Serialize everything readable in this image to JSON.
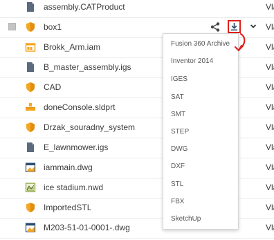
{
  "files": [
    {
      "name": "assembly.CATProduct",
      "icon": "document-icon",
      "owner": "Vla",
      "selected": false
    },
    {
      "name": "box1",
      "icon": "shield-part-icon",
      "owner": "Vla",
      "selected": true
    },
    {
      "name": "Brokk_Arm.iam",
      "icon": "assembly-icon",
      "owner": "Vla",
      "selected": false
    },
    {
      "name": "B_master_assembly.igs",
      "icon": "document-icon",
      "owner": "Vla",
      "selected": false
    },
    {
      "name": "CAD",
      "icon": "shield-part-icon",
      "owner": "Vla",
      "selected": false
    },
    {
      "name": "doneConsole.sldprt",
      "icon": "solidworks-part-icon",
      "owner": "Vla",
      "selected": false
    },
    {
      "name": "Drzak_souradny_system",
      "icon": "shield-part-icon",
      "owner": "Vla",
      "selected": false
    },
    {
      "name": "E_lawnmower.igs",
      "icon": "document-icon",
      "owner": "Vla",
      "selected": false
    },
    {
      "name": "iammain.dwg",
      "icon": "drawing-icon",
      "owner": "Vla",
      "selected": false
    },
    {
      "name": "ice stadium.nwd",
      "icon": "navisworks-icon",
      "owner": "Vla",
      "selected": false
    },
    {
      "name": "ImportedSTL",
      "icon": "shield-part-icon",
      "owner": "Vla",
      "selected": false
    },
    {
      "name": "M203-51-01-0001-.dwg",
      "icon": "drawing-icon",
      "owner": "Vla",
      "selected": false
    }
  ],
  "download_menu": {
    "items": [
      "Fusion 360 Archive",
      "Inventor 2014",
      "IGES",
      "SAT",
      "SMT",
      "STEP",
      "DWG",
      "DXF",
      "STL",
      "FBX",
      "SketchUp"
    ]
  },
  "colors": {
    "accent": "#e0201b",
    "icon_orange": "#f5a623",
    "icon_gray": "#5b6b7d",
    "icon_navy": "#2b4a6f"
  }
}
